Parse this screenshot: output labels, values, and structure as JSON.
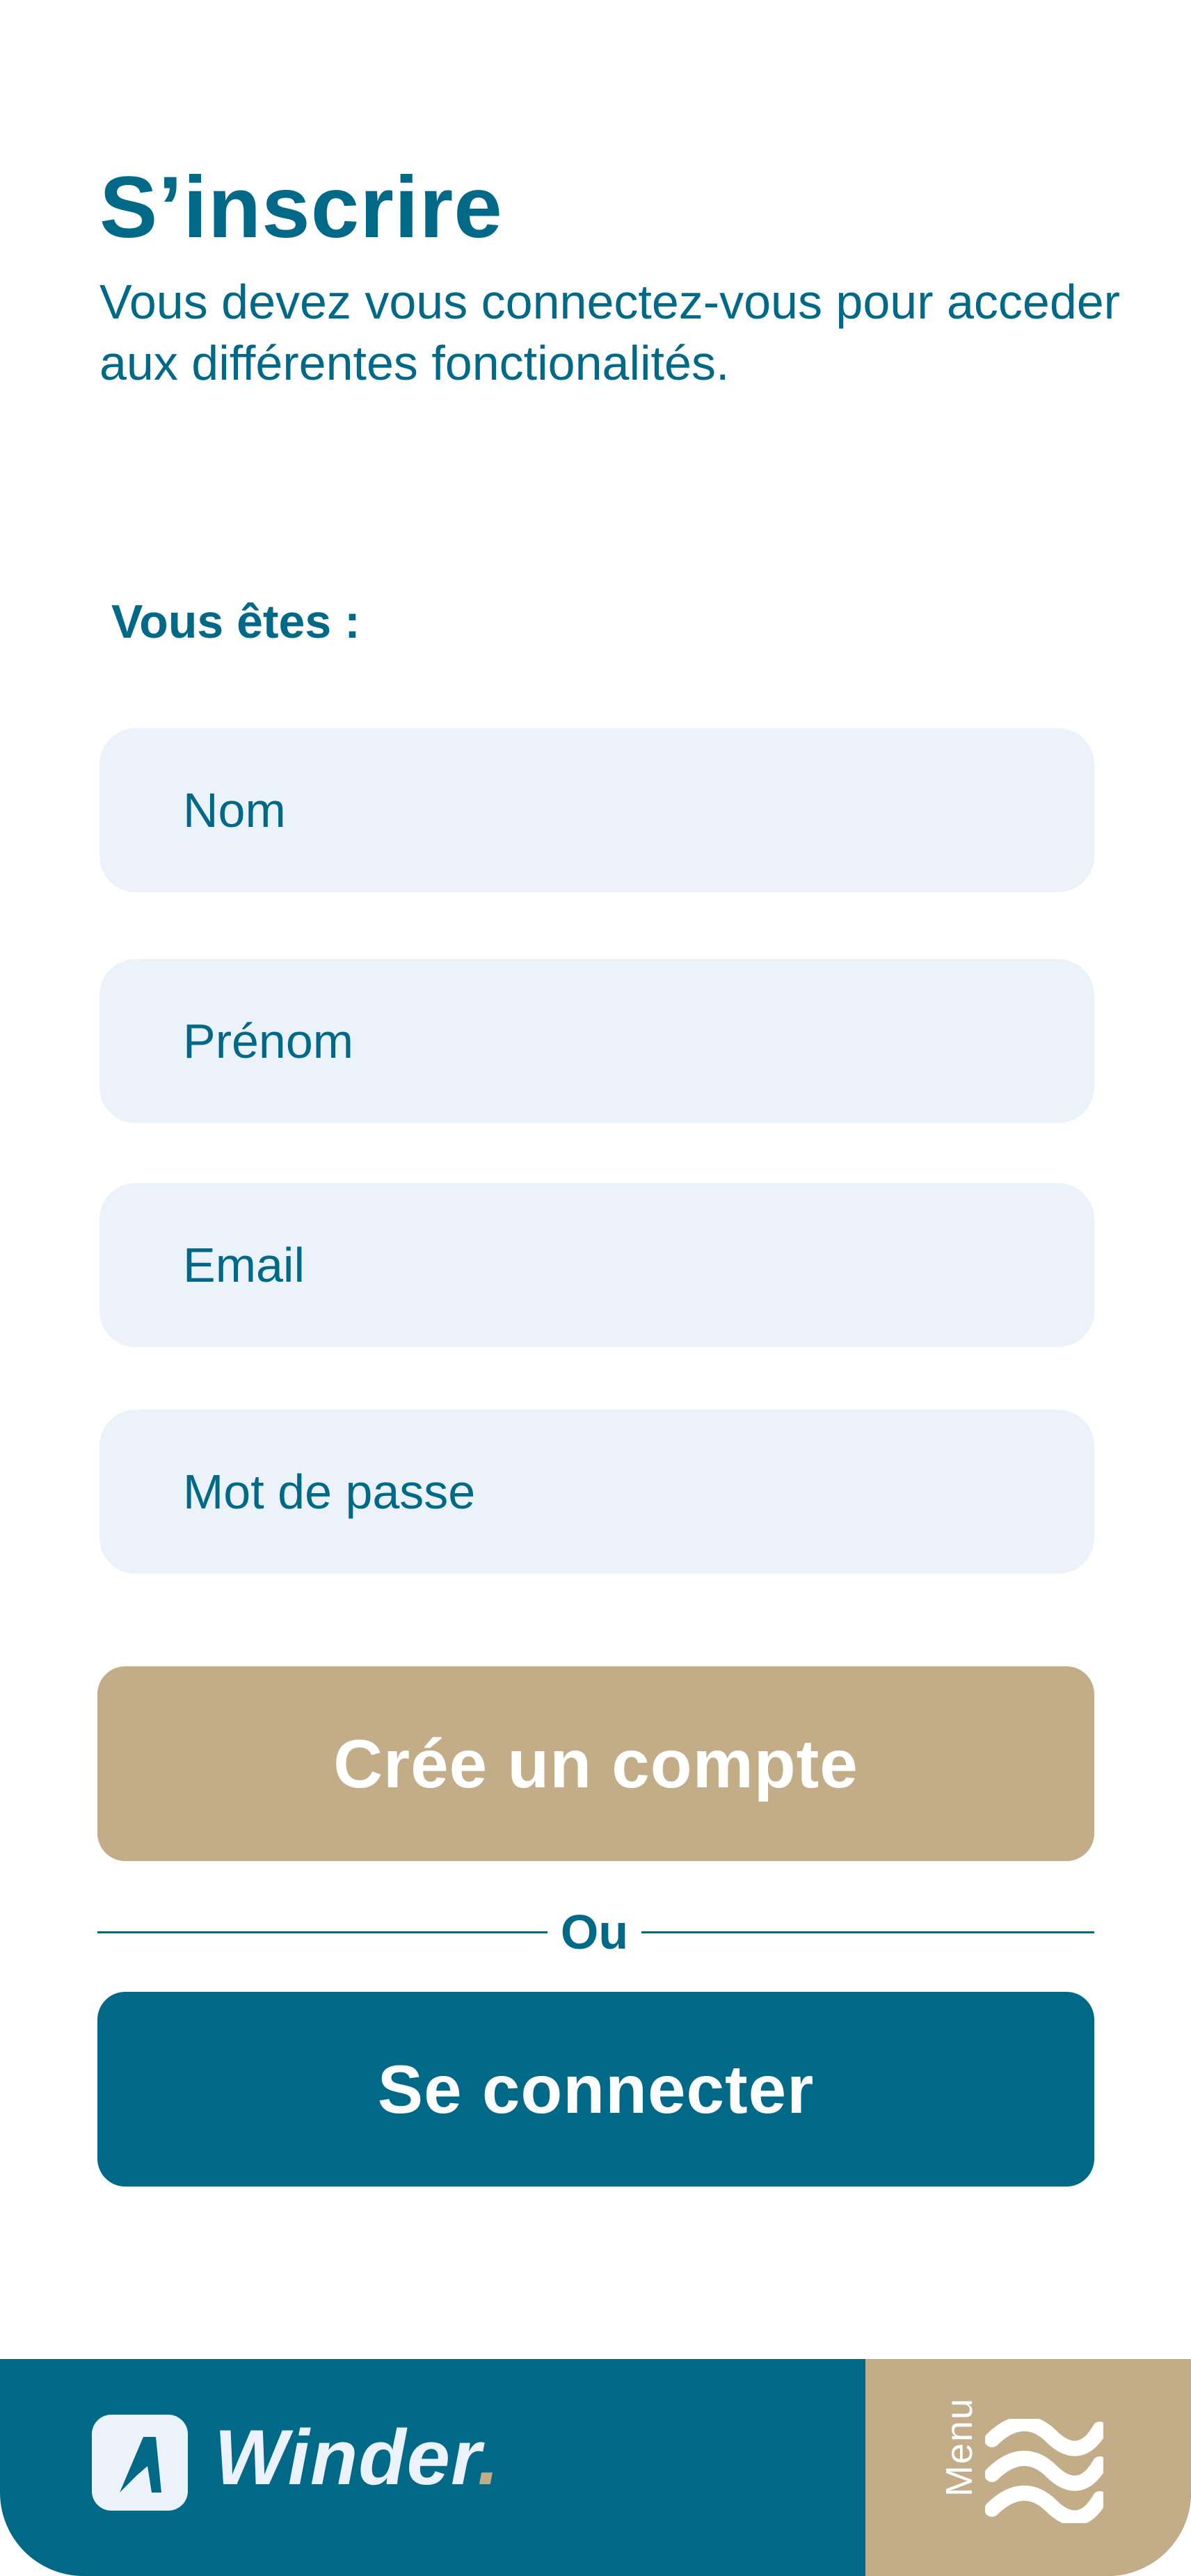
{
  "header": {
    "title": "S’inscrire",
    "subtitle": "Vous devez vous connectez-vous pour acceder aux différentes fonctionalités."
  },
  "form": {
    "section_label": "Vous êtes :",
    "fields": [
      {
        "placeholder": "Nom",
        "value": ""
      },
      {
        "placeholder": "Prénom",
        "value": ""
      },
      {
        "placeholder": "Email",
        "value": ""
      },
      {
        "placeholder": "Mot de passe",
        "value": ""
      }
    ],
    "create_account_label": "Crée un compte",
    "or_label": "Ou",
    "login_label": "Se connecter"
  },
  "footer": {
    "brand": "Winder",
    "brand_dot": ".",
    "menu_label": "Menu",
    "icons": [
      "winder-logo-icon",
      "waves-menu-icon"
    ]
  },
  "colors": {
    "primary": "#006987",
    "accent": "#c3ad88",
    "field_background": "#ebf2f9",
    "background": "#ffffff"
  }
}
